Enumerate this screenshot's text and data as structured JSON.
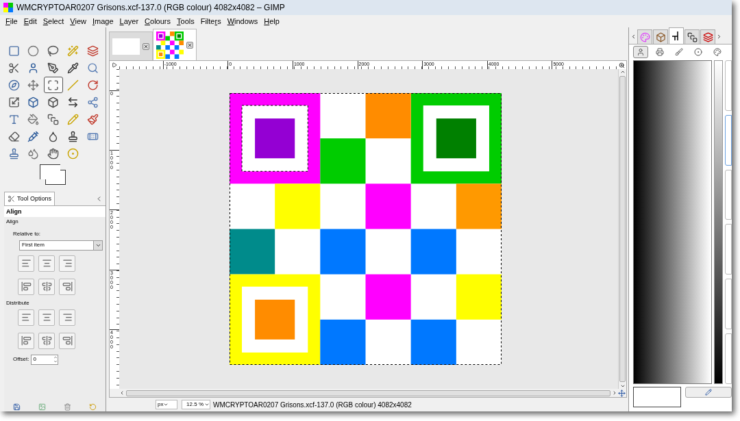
{
  "window": {
    "title": "WMCRYPTOAR0207 Grisons.xcf-137.0 (RGB colour) 4082x4082 – GIMP"
  },
  "menu": [
    {
      "label": "File"
    },
    {
      "label": "Edit"
    },
    {
      "label": "Select"
    },
    {
      "label": "View"
    },
    {
      "label": "Image"
    },
    {
      "label": "Layer"
    },
    {
      "label": "Colours"
    },
    {
      "label": "Tools"
    },
    {
      "label": "Filters"
    },
    {
      "label": "Windows"
    },
    {
      "label": "Help"
    }
  ],
  "image_tabs": [
    {
      "kind": "blank",
      "selected": false
    },
    {
      "kind": "thumbnail",
      "selected": true
    }
  ],
  "tools": [
    {
      "selected": false
    },
    {
      "selected": false
    },
    {
      "selected": false
    },
    {
      "selected": false
    },
    {
      "selected": false
    },
    {
      "selected": false
    },
    {
      "selected": false
    },
    {
      "selected": false
    },
    {
      "selected": false
    },
    {
      "selected": false
    },
    {
      "selected": false
    },
    {
      "selected": false
    },
    {
      "selected": true
    },
    {
      "selected": false
    },
    {
      "selected": false
    },
    {
      "selected": false
    },
    {
      "selected": false
    },
    {
      "selected": false
    },
    {
      "selected": false
    },
    {
      "selected": false
    },
    {
      "selected": false
    },
    {
      "selected": false
    },
    {
      "selected": false
    },
    {
      "selected": false
    },
    {
      "selected": false
    },
    {
      "selected": false
    },
    {
      "selected": false
    },
    {
      "selected": false
    },
    {
      "selected": false
    },
    {
      "selected": false
    },
    {
      "selected": false
    },
    {
      "selected": false
    },
    {
      "selected": false
    },
    {
      "selected": false
    }
  ],
  "tool_options": {
    "tab": "Tool Options",
    "heading": "Align",
    "section": "Align",
    "relative_label": "Relative to:",
    "relative_value": "First item",
    "distribute_label": "Distribute",
    "offset_label": "Offset:",
    "offset_value": "0"
  },
  "rulers": {
    "horizontal": [
      "-1000",
      "0",
      "1000",
      "2000",
      "3000",
      "4000",
      "5000"
    ],
    "vertical": [
      "0",
      "1000",
      "2000",
      "3000",
      "4000"
    ]
  },
  "status_bar": {
    "unit": "px",
    "zoom": "12.5 %",
    "info": "WMCRYPTOAR0207 Grisons.xcf-137.0 (RGB colour) 4082x4082"
  },
  "dock": {
    "tabs": [
      {
        "selected": false
      },
      {
        "selected": false
      },
      {
        "selected": true
      },
      {
        "selected": false
      },
      {
        "selected": false
      }
    ],
    "tools": [
      {
        "selected": true
      },
      {
        "selected": false
      },
      {
        "selected": false
      },
      {
        "selected": false
      },
      {
        "selected": false
      }
    ],
    "panels": [
      {
        "selected": false
      },
      {
        "selected": true
      },
      {
        "selected": false
      },
      {
        "selected": false
      },
      {
        "selected": false
      },
      {
        "selected": false
      }
    ]
  }
}
